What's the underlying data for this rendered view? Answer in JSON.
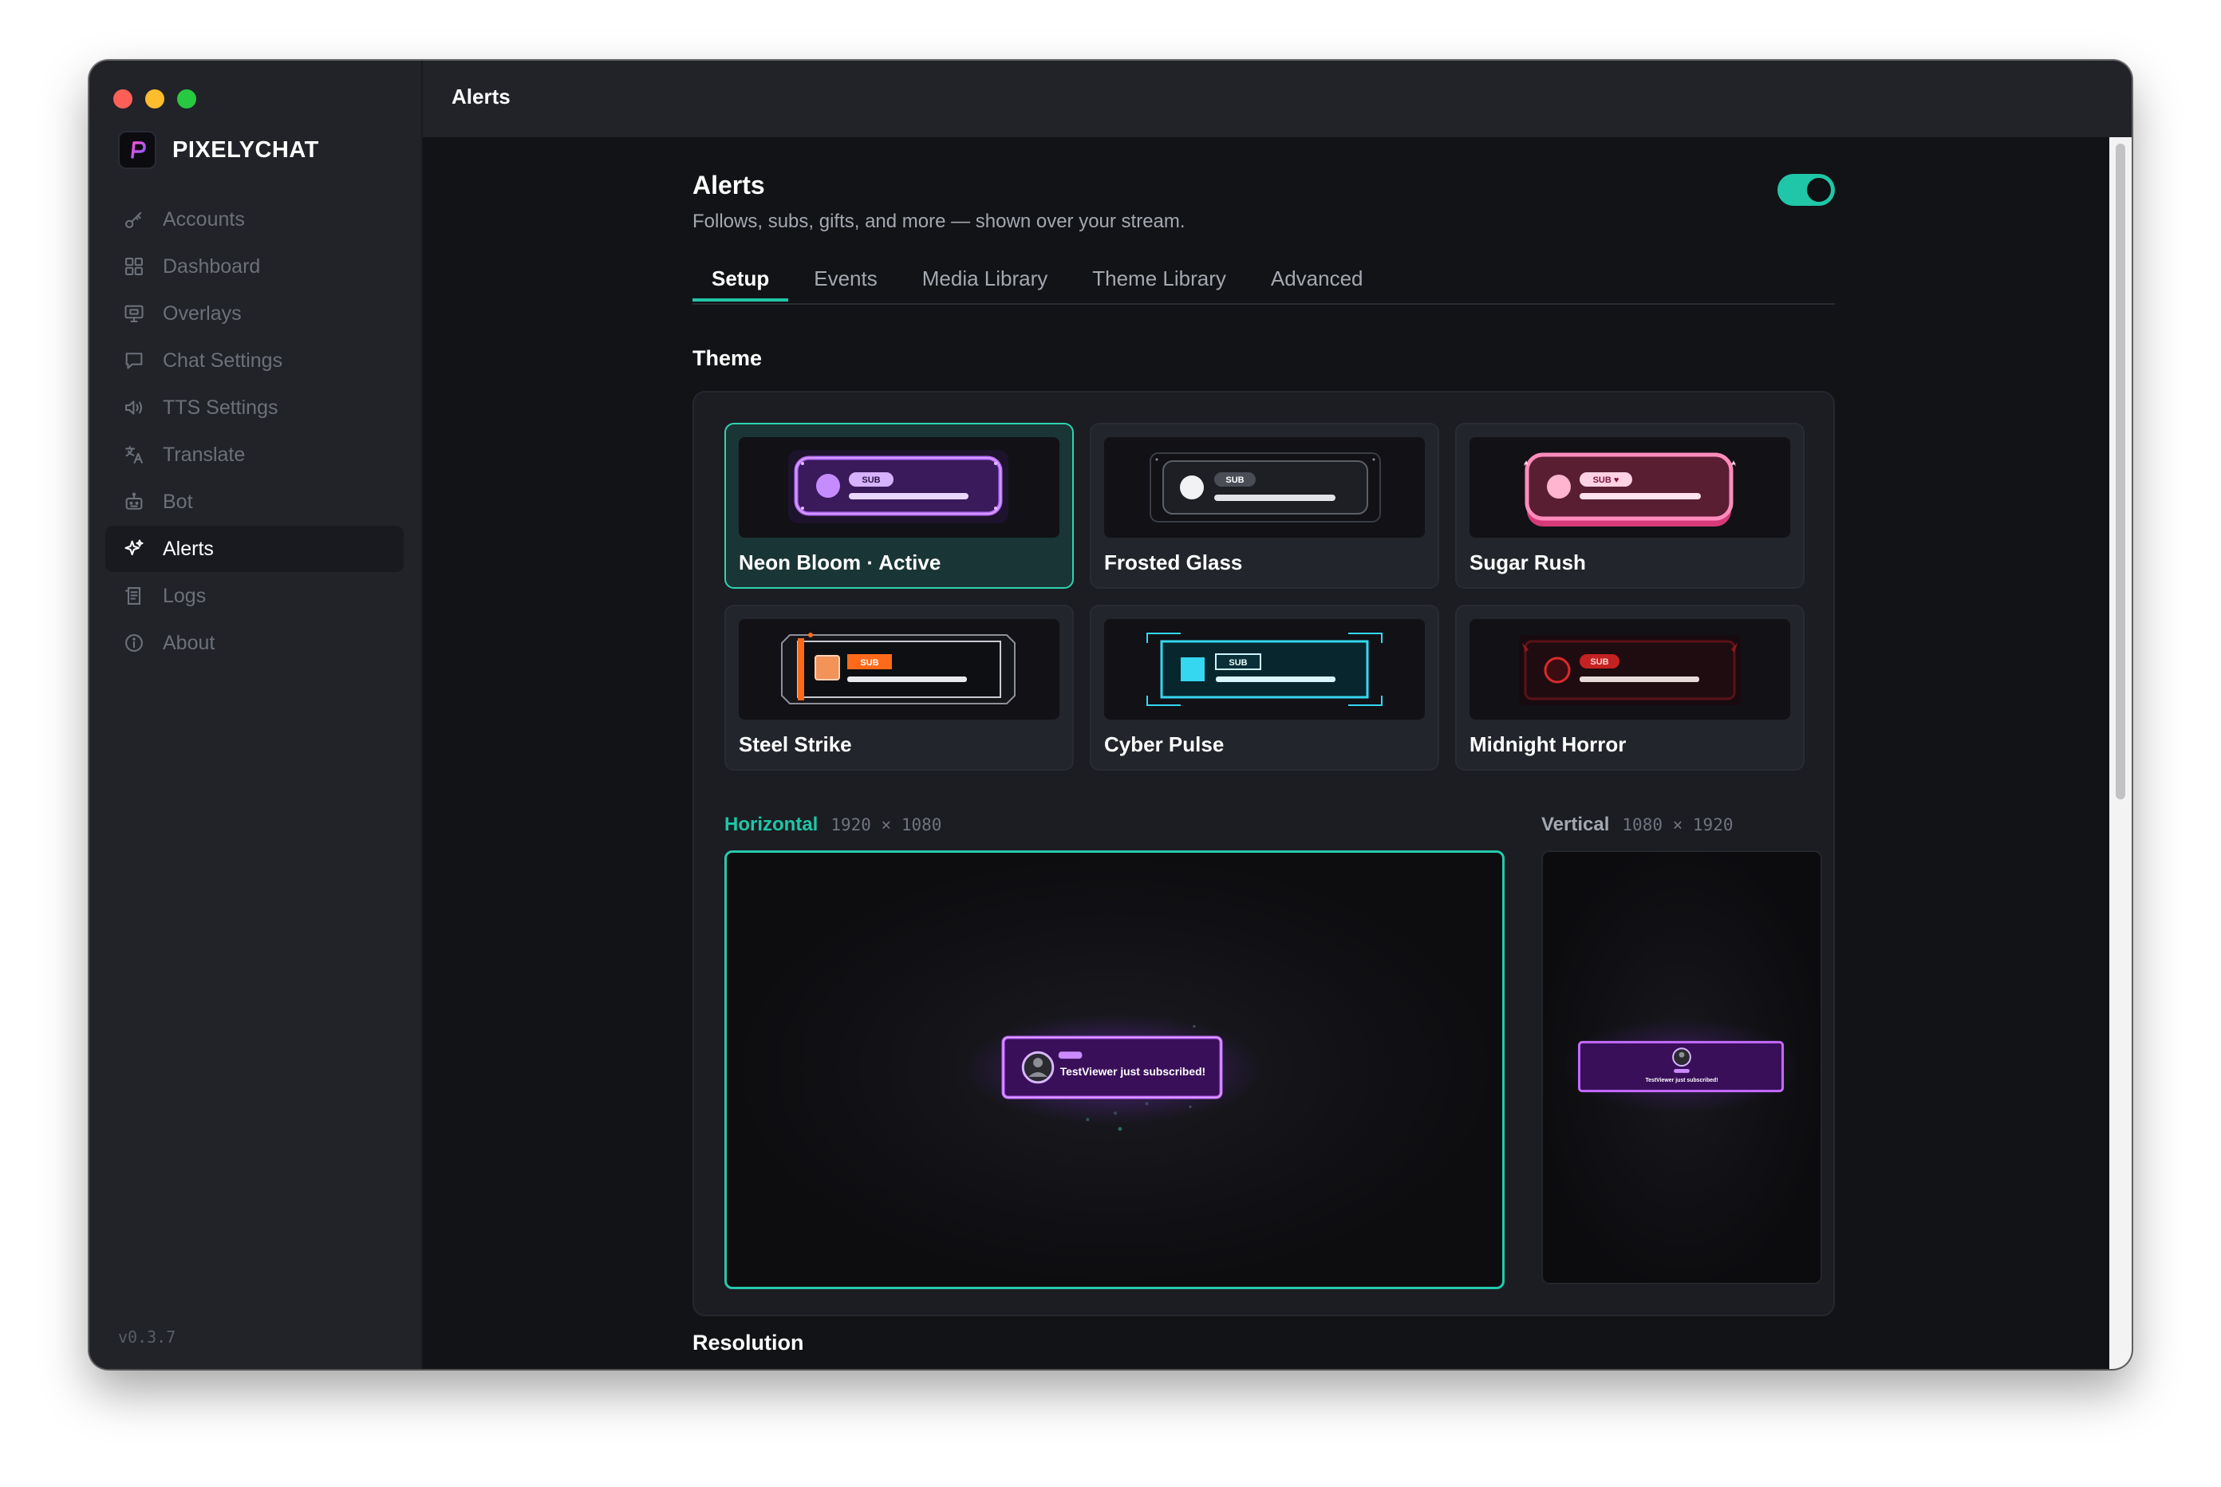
{
  "app": {
    "brand": "PIXELYCHAT",
    "version": "v0.3.7",
    "window_title": "Alerts"
  },
  "sidebar": {
    "items": [
      {
        "label": "Accounts",
        "icon": "key-icon",
        "active": false
      },
      {
        "label": "Dashboard",
        "icon": "grid-icon",
        "active": false
      },
      {
        "label": "Overlays",
        "icon": "monitor-icon",
        "active": false
      },
      {
        "label": "Chat Settings",
        "icon": "chat-bubble-icon",
        "active": false
      },
      {
        "label": "TTS Settings",
        "icon": "speaker-icon",
        "active": false
      },
      {
        "label": "Translate",
        "icon": "translate-icon",
        "active": false
      },
      {
        "label": "Bot",
        "icon": "robot-icon",
        "active": false
      },
      {
        "label": "Alerts",
        "icon": "sparkle-icon",
        "active": true
      },
      {
        "label": "Logs",
        "icon": "log-icon",
        "active": false
      },
      {
        "label": "About",
        "icon": "info-icon",
        "active": false
      }
    ]
  },
  "header": {
    "title": "Alerts",
    "subtitle": "Follows, subs, gifts, and more — shown over your stream.",
    "enabled": true
  },
  "tabs": [
    {
      "label": "Setup",
      "active": true
    },
    {
      "label": "Events",
      "active": false
    },
    {
      "label": "Media Library",
      "active": false
    },
    {
      "label": "Theme Library",
      "active": false
    },
    {
      "label": "Advanced",
      "active": false
    }
  ],
  "theme": {
    "section_title": "Theme",
    "cards": [
      {
        "label": "Neon Bloom · Active",
        "badge": "SUB",
        "active": true
      },
      {
        "label": "Frosted Glass",
        "badge": "SUB",
        "active": false
      },
      {
        "label": "Sugar Rush",
        "badge": "SUB ♥",
        "active": false
      },
      {
        "label": "Steel Strike",
        "badge": "SUB",
        "active": false
      },
      {
        "label": "Cyber Pulse",
        "badge": "SUB",
        "active": false
      },
      {
        "label": "Midnight Horror",
        "badge": "SUB",
        "active": false
      }
    ]
  },
  "preview": {
    "horizontal": {
      "label": "Horizontal",
      "dims": "1920 × 1080"
    },
    "vertical": {
      "label": "Vertical",
      "dims": "1080 × 1920"
    },
    "alert_text": "TestViewer just subscribed!"
  },
  "next_section_title": "Resolution",
  "colors": {
    "accent": "#1fc6a7",
    "neon_purple": "#b86bff",
    "sugar_pink": "#ff5d9e",
    "steel_orange": "#ff6a1a",
    "cyber_cyan": "#35d7f0",
    "horror_red": "#d92b2b"
  }
}
